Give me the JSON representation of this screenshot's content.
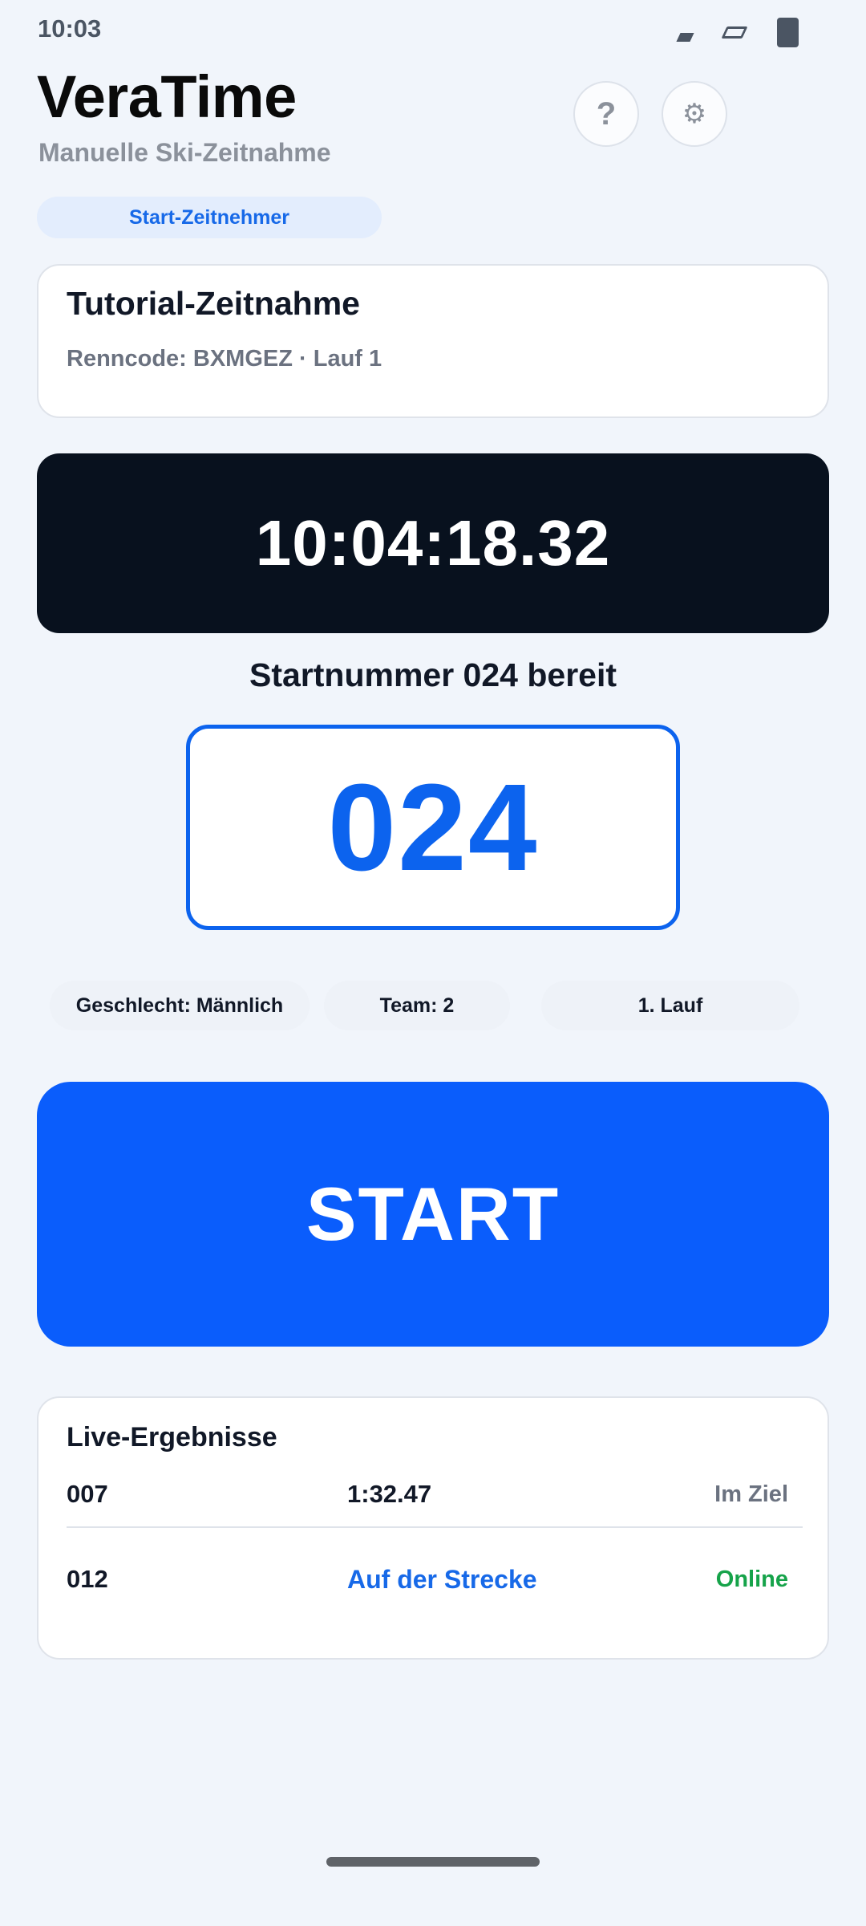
{
  "status_bar": {
    "time": "10:03"
  },
  "header": {
    "title": "VeraTime",
    "subtitle": "Manuelle Ski-Zeitnahme",
    "help_label": "?",
    "settings_icon": "gear-icon",
    "settings_glyph": "⚙"
  },
  "role": {
    "label": "Start-Zeitnehmer"
  },
  "race": {
    "title": "Tutorial-Zeitnahme",
    "subtitle": "Renncode: BXMGEZ · Lauf 1"
  },
  "clock": {
    "time": "10:04:18.32"
  },
  "starter": {
    "ready_text": "Startnummer 024 bereit",
    "bib": "024",
    "gender": "Geschlecht: Männlich",
    "team": "Team: 2",
    "run": "1. Lauf"
  },
  "start_button": {
    "label": "START"
  },
  "results": {
    "title": "Live-Ergebnisse",
    "rows": [
      {
        "bib": "007",
        "time": "1:32.47",
        "status": "Im Ziel"
      },
      {
        "bib": "012",
        "time": "Auf der Strecke",
        "status": "Online"
      }
    ]
  },
  "colors": {
    "accent": "#0a5dfc",
    "clock_bg": "#08111e",
    "online": "#16a34a",
    "background": "#f1f5fb"
  }
}
